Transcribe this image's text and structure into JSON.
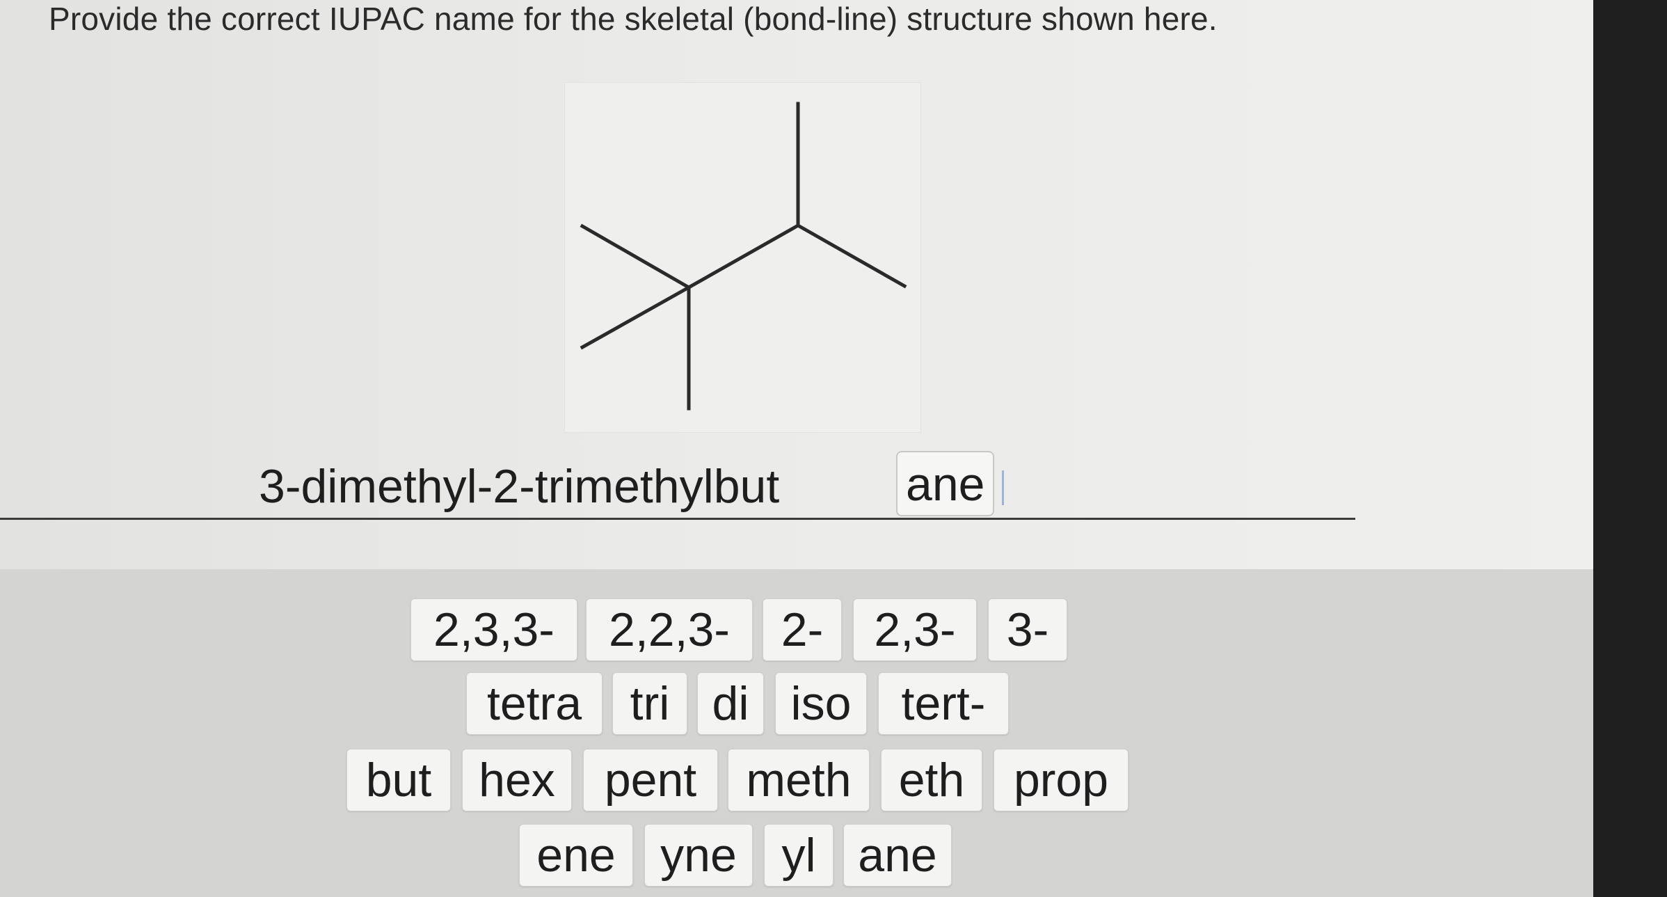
{
  "question": {
    "text": "Provide the correct IUPAC name for the skeletal (bond-line) structure shown here."
  },
  "answer": {
    "typed_text": "3-dimethyl-2-trimethylbut",
    "chip": "ane"
  },
  "word_bank": {
    "row1": [
      "2,3,3-",
      "2,2,3-",
      "2-",
      "2,3-",
      "3-"
    ],
    "row2": [
      "tetra",
      "tri",
      "di",
      "iso",
      "tert-"
    ],
    "row3": [
      "but",
      "hex",
      "pent",
      "meth",
      "eth",
      "prop"
    ],
    "row4": [
      "ene",
      "yne",
      "yl",
      "ane"
    ]
  }
}
